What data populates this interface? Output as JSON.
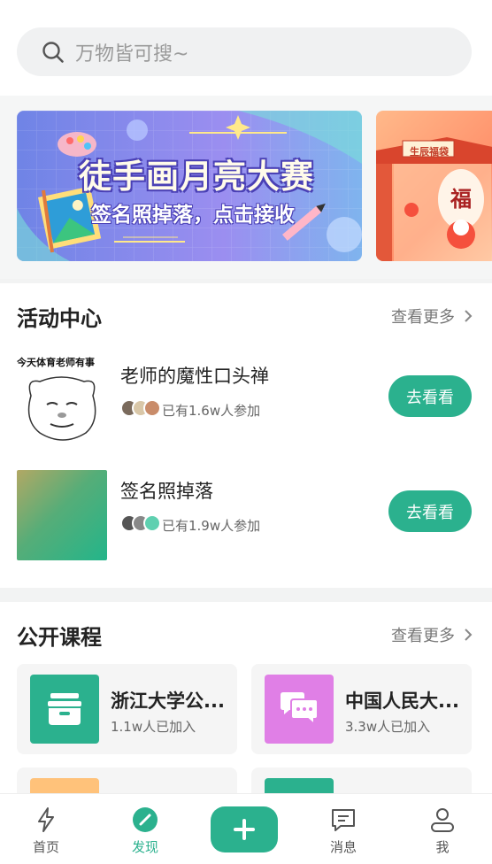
{
  "search": {
    "placeholder": "万物皆可搜~"
  },
  "banners": [
    {
      "title": "徒手画月亮大赛",
      "subtitle": "签名照掉落，点击接收"
    },
    {
      "sign": "生辰福袋",
      "char": "福"
    }
  ],
  "activity": {
    "title": "活动中心",
    "more": "查看更多",
    "items": [
      {
        "title": "老师的魔性口头禅",
        "count": "已有1.6w人参加",
        "button": "去看看",
        "thumb_caption": "今天体育老师有事"
      },
      {
        "title": "签名照掉落",
        "count": "已有1.9w人参加",
        "button": "去看看"
      }
    ]
  },
  "courses": {
    "title": "公开课程",
    "more": "查看更多",
    "items": [
      {
        "title": "浙江大学公...",
        "sub": "1.1w人已加入",
        "color": "#2bb18e"
      },
      {
        "title": "中国人民大...",
        "sub": "3.3w人已加入",
        "color": "#e07fe6"
      }
    ]
  },
  "tabs": [
    {
      "label": "首页"
    },
    {
      "label": "发现"
    },
    {
      "label": "消息"
    },
    {
      "label": "我"
    }
  ],
  "colors": {
    "accent": "#2bb18e"
  }
}
